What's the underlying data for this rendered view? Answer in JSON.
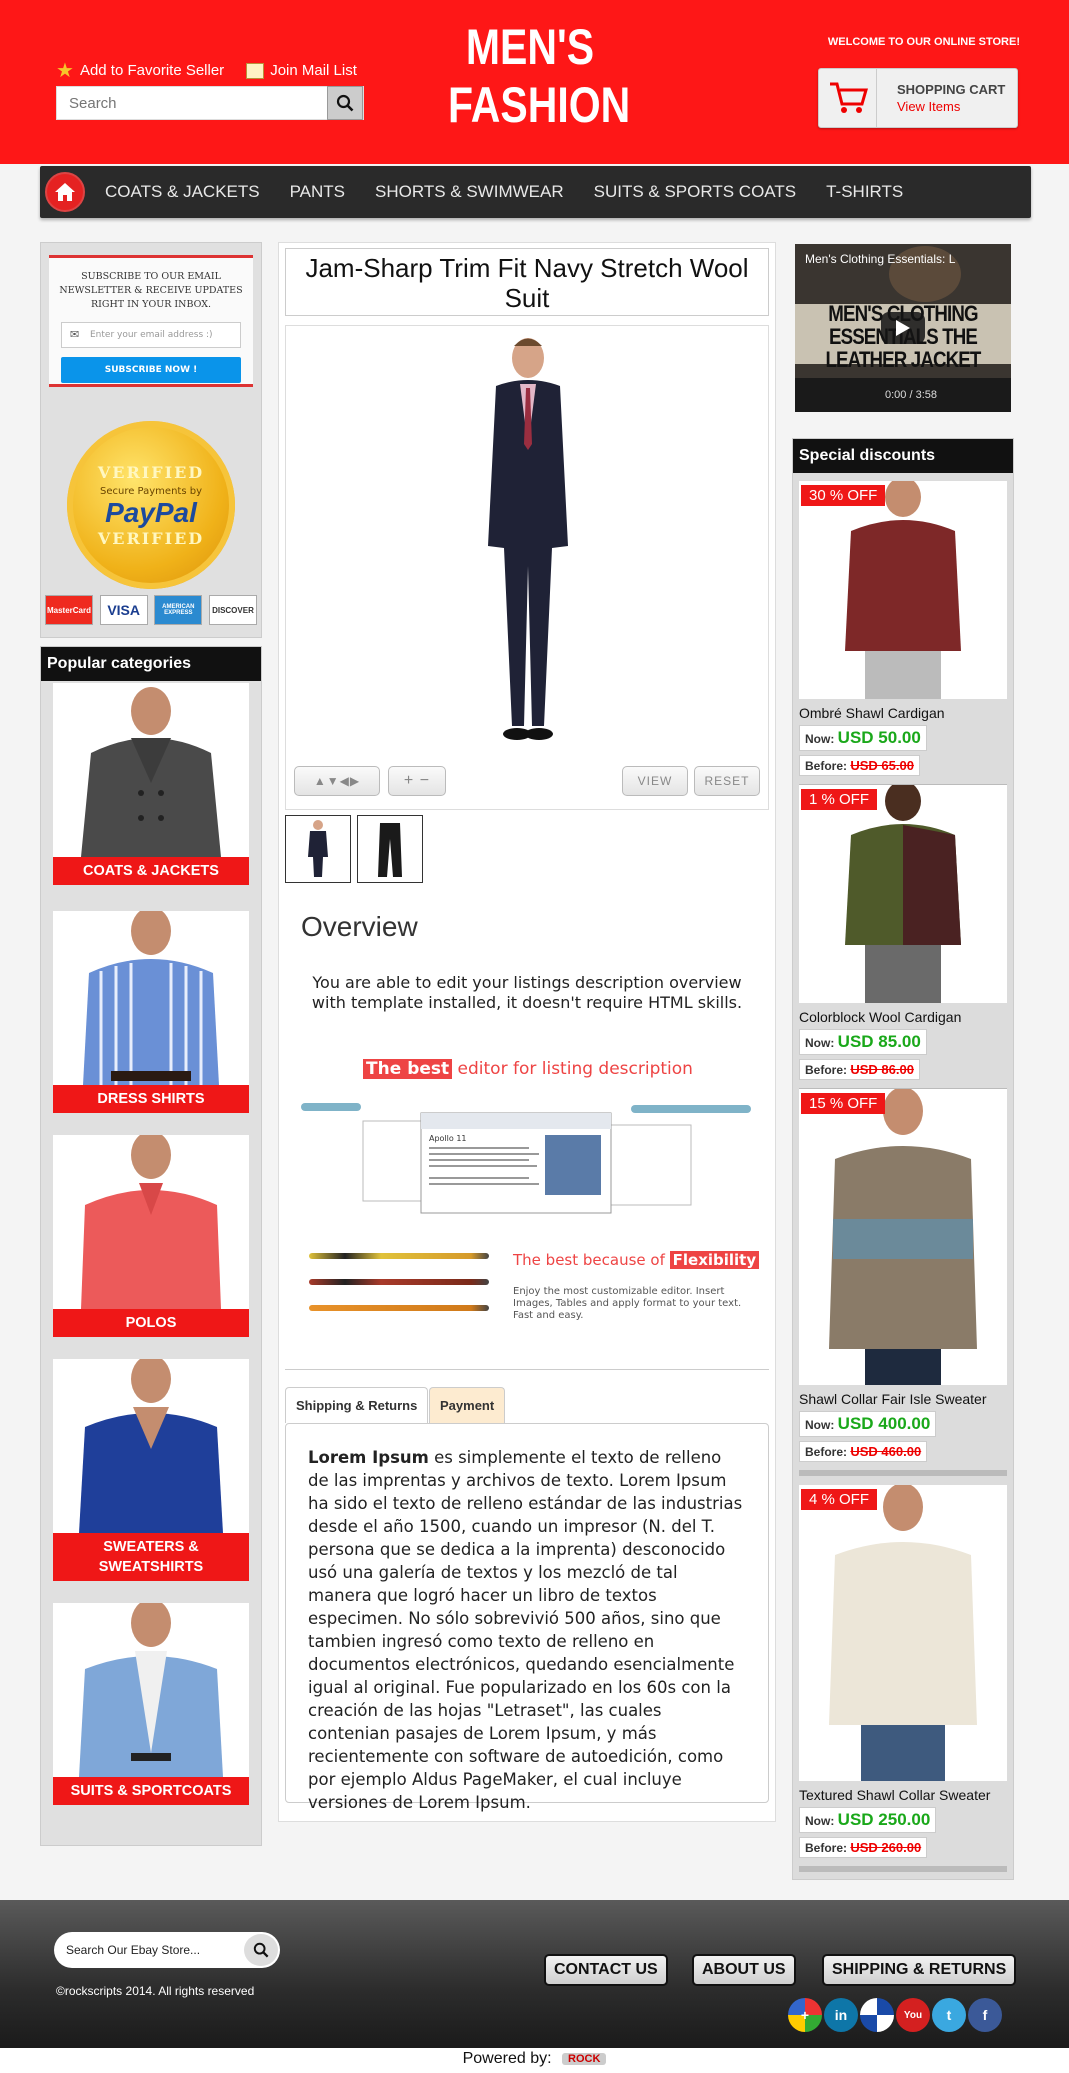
{
  "header": {
    "add_favorite": "Add to Favorite Seller",
    "join_mail": "Join Mail List",
    "search_placeholder": "Search",
    "logo_line1": "MEN'S",
    "logo_line2": "FASHION",
    "welcome": "WELCOME TO OUR ONLINE STORE!",
    "cart_title": "SHOPPING CART",
    "cart_sub": "View Items"
  },
  "nav": {
    "items": [
      "COATS & JACKETS",
      "PANTS",
      "SHORTS & SWIMWEAR",
      "SUITS & SPORTS COATS",
      "T-SHIRTS"
    ]
  },
  "newsletter": {
    "text": "SUBSCRIBE TO OUR EMAIL NEWSLETTER & RECEIVE UPDATES RIGHT IN YOUR INBOX.",
    "placeholder": "Enter your email address :)",
    "button": "SUBSCRIBE NOW !"
  },
  "paypal_seal": {
    "top": "VERIFIED",
    "middle": "Secure Payments by",
    "brand": "PayPal",
    "bottom": "VERIFIED"
  },
  "payment_cards": [
    "MasterCard",
    "VISA",
    "AMERICAN EXPRESS",
    "DISCOVER"
  ],
  "popular": {
    "title": "Popular categories",
    "items": [
      "COATS & JACKETS",
      "DRESS SHIRTS",
      "POLOS",
      "SWEATERS & SWEATSHIRTS",
      "SUITS & SPORTCOATS"
    ]
  },
  "product": {
    "title": "Jam-Sharp Trim Fit Navy Stretch Wool Suit",
    "view_btn": "VIEW",
    "reset_btn": "RESET",
    "overview_heading": "Overview",
    "overview_text": "You are able to edit your listings description overview with template installed, it doesn't require HTML skills.",
    "best_hl": "The best",
    "best_rest": "editor for listing description",
    "editor_window_title": "Apollo 11",
    "best2_prefix": "The best because of",
    "best2_hl": "Flexibility",
    "best2_sub": "Enjoy the most customizable editor. Insert Images, Tables and apply format to your text. Fast and easy.",
    "tabs": [
      "Shipping & Returns",
      "Payment"
    ],
    "tab_text_bold": "Lorem Ipsum",
    "tab_text": " es simplemente el texto de relleno de las imprentas y archivos de texto. Lorem Ipsum ha sido el texto de relleno estándar de las industrias desde el año 1500, cuando un impresor (N. del T. persona que se dedica a la imprenta) desconocido usó una galería de textos y los mezcló de tal manera que logró hacer un libro de textos especimen. No sólo sobrevivió 500 años, sino que tambien ingresó como texto de relleno en documentos electrónicos, quedando esencialmente igual al original. Fue popularizado en los 60s con la creación de las hojas \"Letraset\", las cuales contenian pasajes de Lorem Ipsum, y más recientemente con software de autoedición, como por ejemplo Aldus PageMaker, el cual incluye versiones de Lorem Ipsum."
  },
  "video": {
    "title": "Men's Clothing Essentials: L",
    "overlay": "MEN'S CLOTHING ESSENTIALS THE LEATHER JACKET",
    "time": "0:00 / 3:58"
  },
  "discounts": {
    "title": "Special discounts",
    "now_label": "Now:",
    "before_label": "Before:",
    "items": [
      {
        "badge": "30 % OFF",
        "name": "Ombré Shawl Cardigan",
        "now": "USD 50.00",
        "before": "USD 65.00"
      },
      {
        "badge": "1 % OFF",
        "name": "Colorblock Wool Cardigan",
        "now": "USD 85.00",
        "before": "USD 86.00"
      },
      {
        "badge": "15 % OFF",
        "name": "Shawl Collar Fair Isle Sweater",
        "now": "USD 400.00",
        "before": "USD 460.00"
      },
      {
        "badge": "4 % OFF",
        "name": "Textured Shawl Collar Sweater",
        "now": "USD 250.00",
        "before": "USD 260.00"
      }
    ]
  },
  "footer": {
    "search_placeholder": "Search Our Ebay Store...",
    "copyright": "©rockscripts 2014. All rights reserved",
    "buttons": [
      "CONTACT US",
      "ABOUT US",
      "SHIPPING & RETURNS"
    ],
    "powered": "Powered by:",
    "powered_brand": "ROCK"
  },
  "colors": {
    "brand_red": "#fe1717",
    "nav_dark": "#2a2a2a",
    "price_green": "#1aa81a"
  }
}
